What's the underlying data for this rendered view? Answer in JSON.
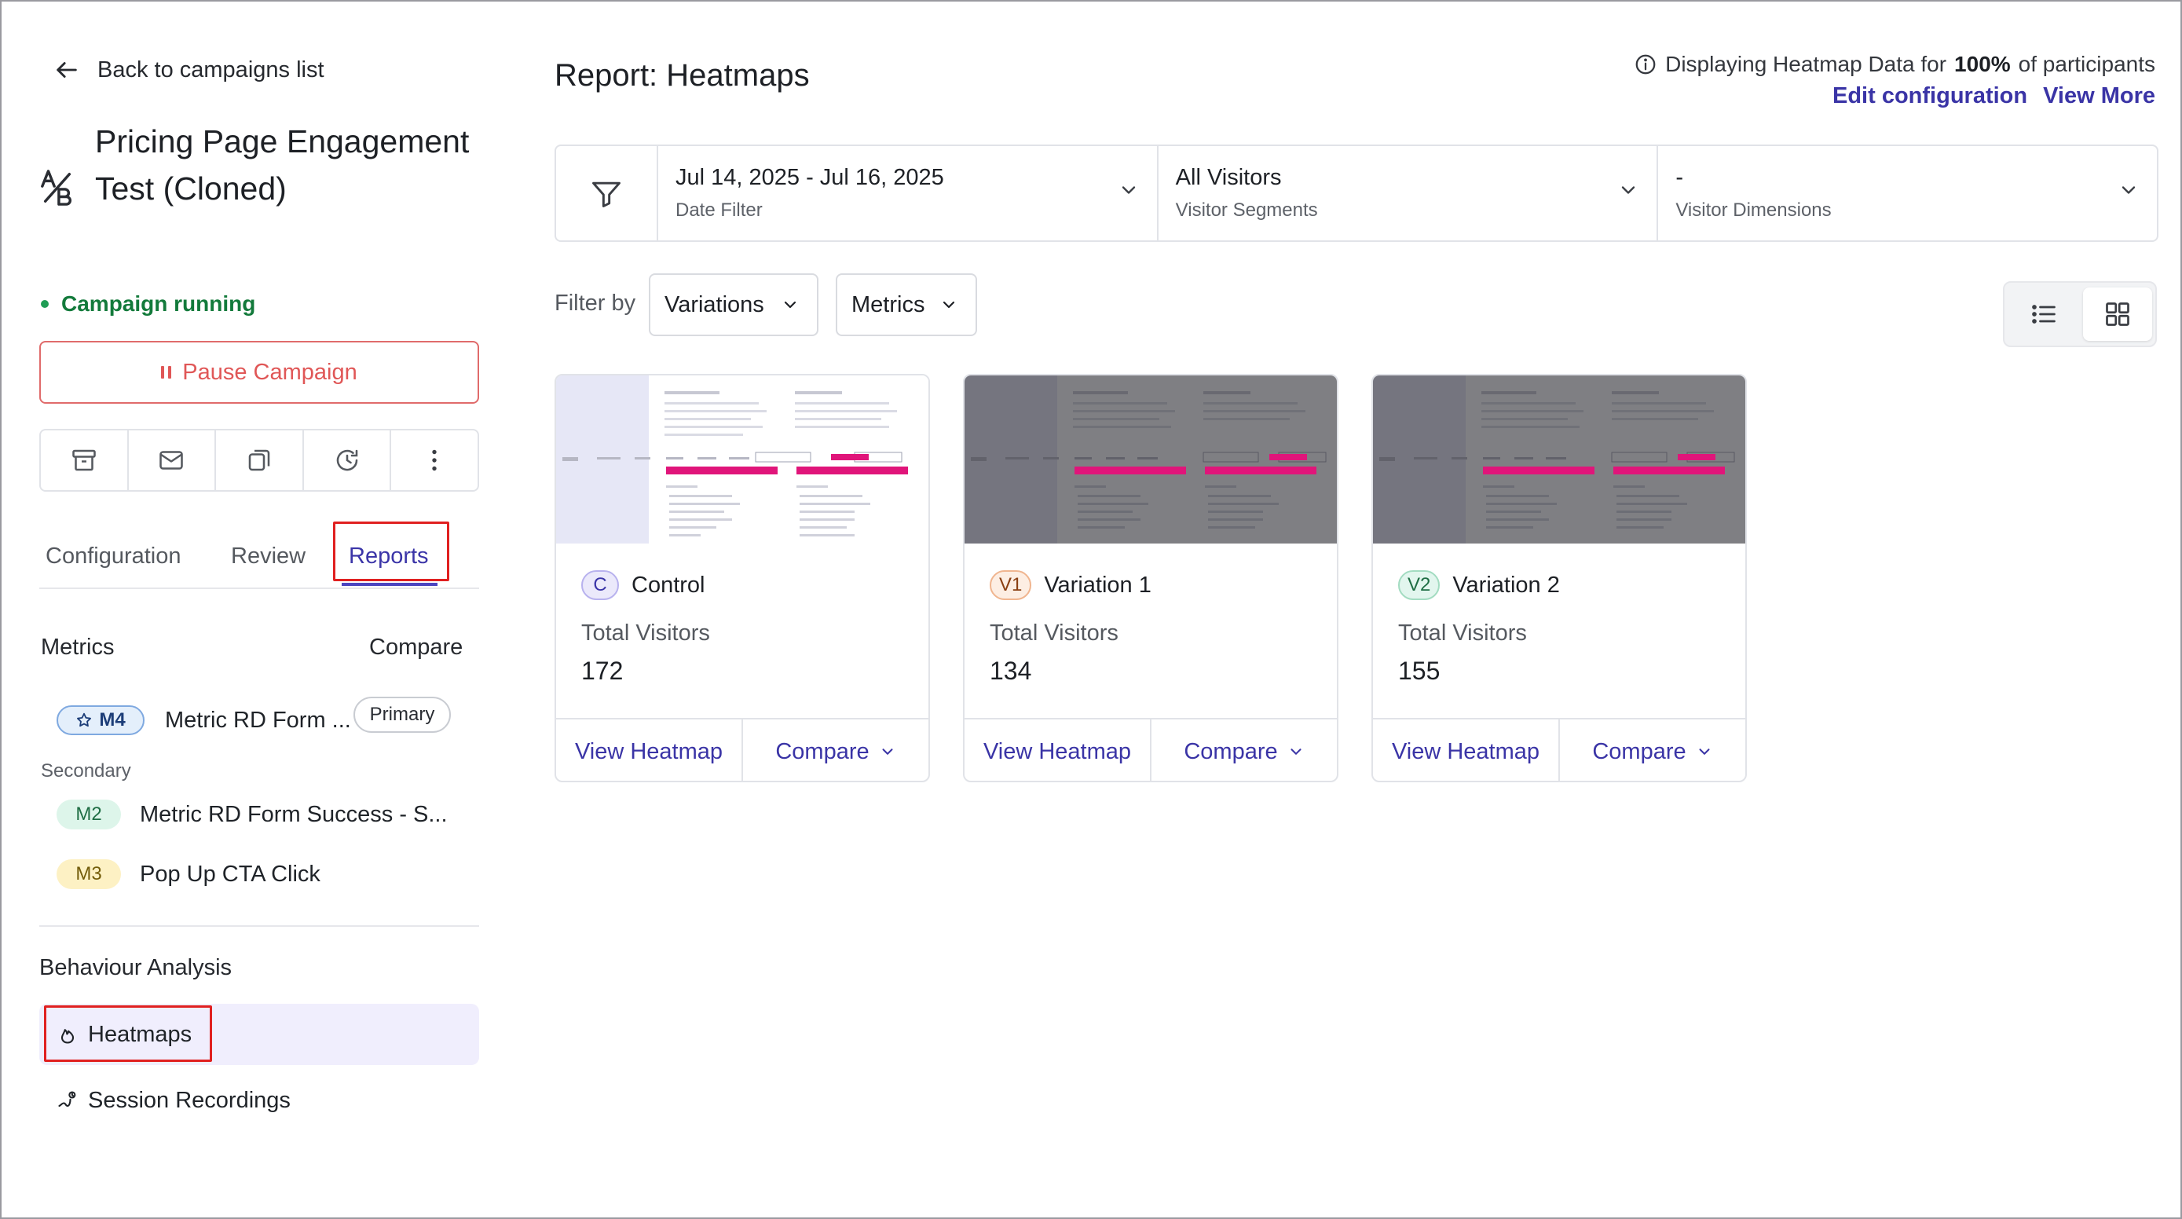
{
  "sidebar": {
    "back_label": "Back to campaigns list",
    "campaign_title": "Pricing Page Engagement Test (Cloned)",
    "status": "Campaign running",
    "pause_label": "Pause Campaign",
    "tabs": [
      {
        "label": "Configuration"
      },
      {
        "label": "Review"
      },
      {
        "label": "Reports"
      }
    ],
    "metrics_heading": "Metrics",
    "compare_heading": "Compare",
    "primary_metric": {
      "badge": "M4",
      "name": "Metric RD Form ...",
      "chip": "Primary"
    },
    "secondary_label": "Secondary",
    "secondary_metrics": [
      {
        "badge": "M2",
        "name": "Metric RD Form Success - S..."
      },
      {
        "badge": "M3",
        "name": "Pop Up CTA Click"
      }
    ],
    "behaviour_heading": "Behaviour Analysis",
    "nav": [
      {
        "label": "Heatmaps"
      },
      {
        "label": "Session Recordings"
      }
    ]
  },
  "main": {
    "title": "Report: Heatmaps",
    "display_prefix": "Displaying Heatmap Data for",
    "display_percent": "100%",
    "display_suffix": "of participants",
    "edit_config": "Edit configuration",
    "view_more": "View More",
    "filters": [
      {
        "value": "Jul 14, 2025 - Jul 16, 2025",
        "label": "Date Filter"
      },
      {
        "value": "All Visitors",
        "label": "Visitor Segments"
      },
      {
        "value": "-",
        "label": "Visitor Dimensions"
      }
    ],
    "filter_by_label": "Filter by",
    "variations_dd": "Variations",
    "metrics_dd": "Metrics",
    "cards": [
      {
        "badge": "C",
        "name": "Control",
        "visitors_label": "Total Visitors",
        "visitors": "172",
        "view_label": "View Heatmap",
        "compare_label": "Compare"
      },
      {
        "badge": "V1",
        "name": "Variation 1",
        "visitors_label": "Total Visitors",
        "visitors": "134",
        "view_label": "View Heatmap",
        "compare_label": "Compare"
      },
      {
        "badge": "V2",
        "name": "Variation 2",
        "visitors_label": "Total Visitors",
        "visitors": "155",
        "view_label": "View Heatmap",
        "compare_label": "Compare"
      }
    ]
  },
  "colors": {
    "accent": "#3a34a6",
    "running": "#137a3b",
    "pause": "#e05757",
    "highlight": "#e02020",
    "cta_pink": "#e0157a"
  }
}
